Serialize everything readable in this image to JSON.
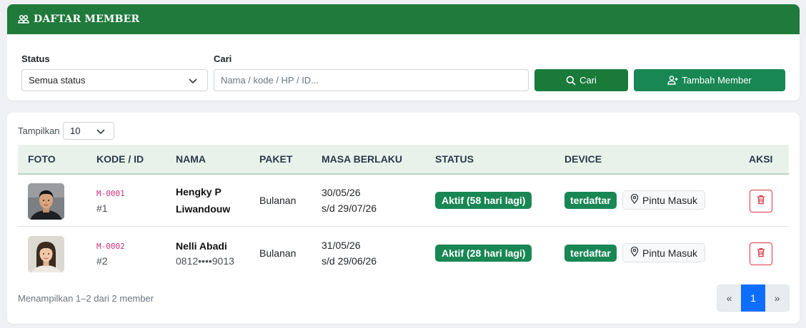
{
  "header": {
    "title": "DAFTAR MEMBER",
    "icon": "users-icon"
  },
  "filters": {
    "status_label": "Status",
    "status_value": "Semua status",
    "search_label": "Cari",
    "search_placeholder": "Nama / kode / HP / ID...",
    "search_button": "Cari",
    "add_button": "Tambah Member"
  },
  "table": {
    "show_label": "Tampilkan",
    "page_size": "10",
    "columns": [
      "FOTO",
      "KODE / ID",
      "NAMA",
      "PAKET",
      "MASA BERLAKU",
      "STATUS",
      "DEVICE",
      "AKSI"
    ],
    "rows": [
      {
        "code": "M-0001",
        "id": "#1",
        "name_line1": "Hengky P",
        "name_line2": "Liwandouw",
        "package": "Bulanan",
        "valid_from": "30/05/26",
        "valid_to": "s/d 29/07/26",
        "status": "Aktif (58 hari lagi)",
        "device_status": "terdaftar",
        "device_location": "Pintu Masuk"
      },
      {
        "code": "M-0002",
        "id": "#2",
        "name_line1": "Nelli Abadi",
        "name_line2": "0812••••9013",
        "package": "Bulanan",
        "valid_from": "31/05/26",
        "valid_to": "s/d 29/06/26",
        "status": "Aktif (28 hari lagi)",
        "device_status": "terdaftar",
        "device_location": "Pintu Masuk"
      }
    ]
  },
  "footer": {
    "summary": "Menampilkan 1–2 dari 2 member",
    "prev": "«",
    "current_page": "1",
    "next": "»"
  },
  "colors": {
    "header_green": "#1f7a3b",
    "button_green": "#198754",
    "page_active": "#0d6efd",
    "danger": "#dc3545"
  }
}
